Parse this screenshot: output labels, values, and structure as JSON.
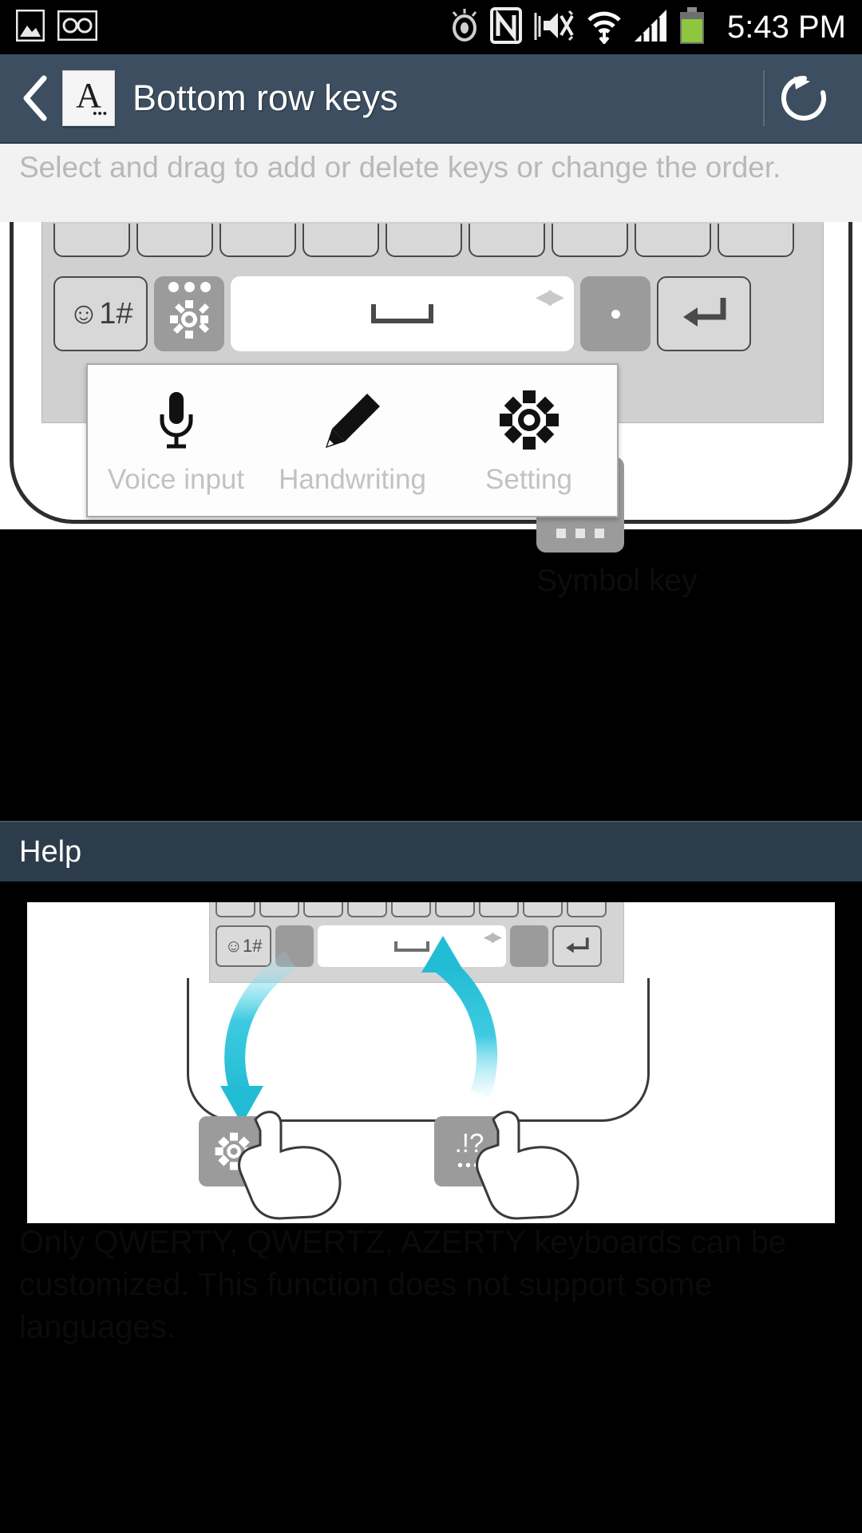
{
  "statusbar": {
    "time": "5:43 PM",
    "left_icons": [
      "gallery-image-icon",
      "voicemail-icon"
    ],
    "right_icons": [
      "smart-stay-eye-icon",
      "nfc-icon",
      "sound-mute-vibrate-icon",
      "wifi-icon",
      "cellular-signal-icon",
      "battery-icon"
    ]
  },
  "titlebar": {
    "back_label": "‹",
    "app_icon_letter": "A",
    "app_icon_dots": "•••",
    "title": "Bottom row keys",
    "reset_icon": "reset-undo-icon"
  },
  "instruction": {
    "text": "Select and drag to add or delete keys or change the order."
  },
  "keyboard_preview": {
    "top_row_key_count": 9,
    "bottom_row": [
      {
        "name": "symbol-emoji-key",
        "label": "☺1#",
        "style": "outline"
      },
      {
        "name": "settings-gear-key",
        "label": "",
        "style": "filled"
      },
      {
        "name": "space-key",
        "label": "",
        "style": "white"
      },
      {
        "name": "period-key",
        "label": ".",
        "style": "filled"
      },
      {
        "name": "enter-key",
        "label": "↵",
        "style": "outline"
      }
    ]
  },
  "popup": {
    "items": [
      {
        "icon": "microphone-icon",
        "label": "Voice input"
      },
      {
        "icon": "pencil-handwriting-icon",
        "label": "Handwriting"
      },
      {
        "icon": "gear-setting-icon",
        "label": "Setting"
      }
    ]
  },
  "symbol_callout": {
    "label": "Symbol key"
  },
  "help": {
    "section_title": "Help",
    "keys": [
      {
        "name": "help-gear-key",
        "label": "gear-icon"
      },
      {
        "name": "help-symbol-key",
        "line1": ".!?",
        "line2": "•••"
      }
    ],
    "note": "Only QWERTY, QWERTZ, AZERTY keyboards can be customized. This function does not support some languages."
  },
  "colors": {
    "titlebar": "#3c4e5f",
    "help_bar": "#2c3c4a",
    "instruction_bg": "#f2f2f2",
    "instruction_text": "#b8b8b8",
    "key_fill": "#9b9b9b",
    "key_outline": "#d8d8d8",
    "background": "#000000",
    "battery_green": "#8ec63f"
  }
}
